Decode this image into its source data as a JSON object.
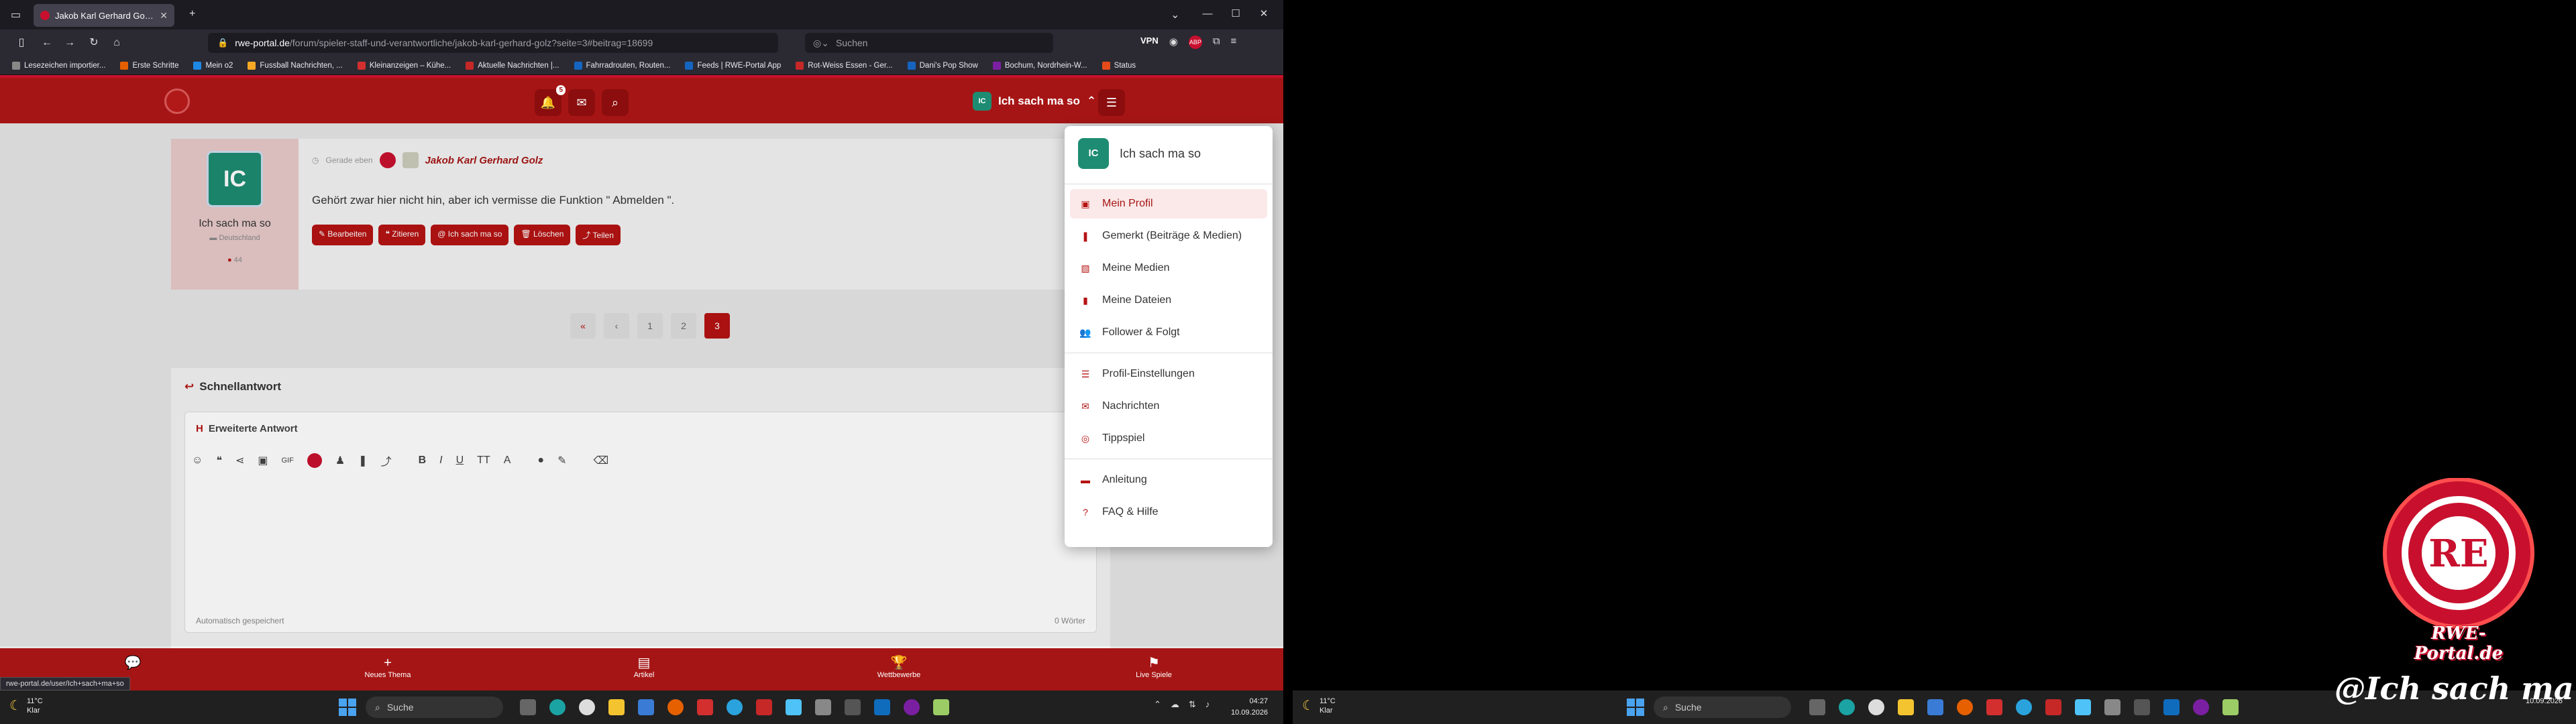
{
  "browser": {
    "tab_title": "Jakob Karl Gerhard Golz - RWE",
    "url_domain": "rwe-portal.de",
    "url_path": "/forum/spieler-staff-und-verantwortliche/jakob-karl-gerhard-golz?seite=3#beitrag=18699",
    "search_placeholder": "Suchen",
    "vpn_label": "VPN",
    "abp_label": "ABP",
    "bookmarks": [
      "Lesezeichen importier...",
      "Erste Schritte",
      "Mein o2",
      "Fussball Nachrichten, ...",
      "Kleinanzeigen – Kühe...",
      "Aktuelle Nachrichten |...",
      "Fahrradrouten, Routen...",
      "Feeds | RWE-Portal App",
      "Rot-Weiss Essen - Ger...",
      "Dani's Pop Show",
      "Bochum, Nordrhein-W...",
      "Status"
    ],
    "hover_url": "rwe-portal.de/user/Ich+sach+ma+so"
  },
  "header": {
    "notification_count": "5",
    "username": "Ich sach ma so",
    "avatar_initials": "IC"
  },
  "post": {
    "author_initials": "IC",
    "author_name": "Ich sach ma so",
    "author_country": "Deutschland",
    "author_post_count": "44",
    "time": "Gerade eben",
    "thread_subject": "Jakob Karl Gerhard Golz",
    "text": "Gehört zwar hier nicht hin, aber ich vermisse die Funktion \" Abmelden \".",
    "actions": [
      "Bearbeiten",
      "Zitieren",
      "Ich sach ma so",
      "Löschen",
      "Teilen"
    ]
  },
  "pagination": {
    "first": "«",
    "prev": "‹",
    "pages": [
      "1",
      "2",
      "3"
    ],
    "active": "3"
  },
  "quick_reply": {
    "title": "Schnellantwort",
    "attach_count": "0",
    "editor_title": "Erweiterte Antwort",
    "status": "Automatisch gespeichert",
    "words": "0 Wörter"
  },
  "bottom_nav": [
    {
      "label": "Neues Thema",
      "icon": "+"
    },
    {
      "label": "Artikel",
      "icon": "▤"
    },
    {
      "label": "Wettbewerbe",
      "icon": "🏆"
    },
    {
      "label": "Live Spiele",
      "icon": "⚑"
    }
  ],
  "user_menu": {
    "username": "Ich sach ma so",
    "initials": "IC",
    "items": [
      {
        "label": "Mein Profil",
        "icon": "▣"
      },
      {
        "label": "Gemerkt (Beiträge & Medien)",
        "icon": "❚"
      },
      {
        "label": "Meine Medien",
        "icon": "▧"
      },
      {
        "label": "Meine Dateien",
        "icon": "▮"
      },
      {
        "label": "Follower & Folgt",
        "icon": "👥"
      },
      {
        "label": "Profil-Einstellungen",
        "icon": "☰"
      },
      {
        "label": "Nachrichten",
        "icon": "✉"
      },
      {
        "label": "Tippspiel",
        "icon": "◎"
      },
      {
        "label": "Anleitung",
        "icon": "▬"
      },
      {
        "label": "FAQ & Hilfe",
        "icon": "?"
      }
    ]
  },
  "taskbar": {
    "temp": "11°C",
    "weather": "Klar",
    "search_label": "Suche",
    "time": "04:27",
    "date": "10.09.2026"
  },
  "wallpaper": {
    "logo_text": "RWE-Portal.de",
    "signature": "@Ich sach ma so"
  },
  "colors": {
    "brand_red": "#a61515",
    "button_red": "#b51313",
    "avatar_green": "#1e8c72"
  }
}
